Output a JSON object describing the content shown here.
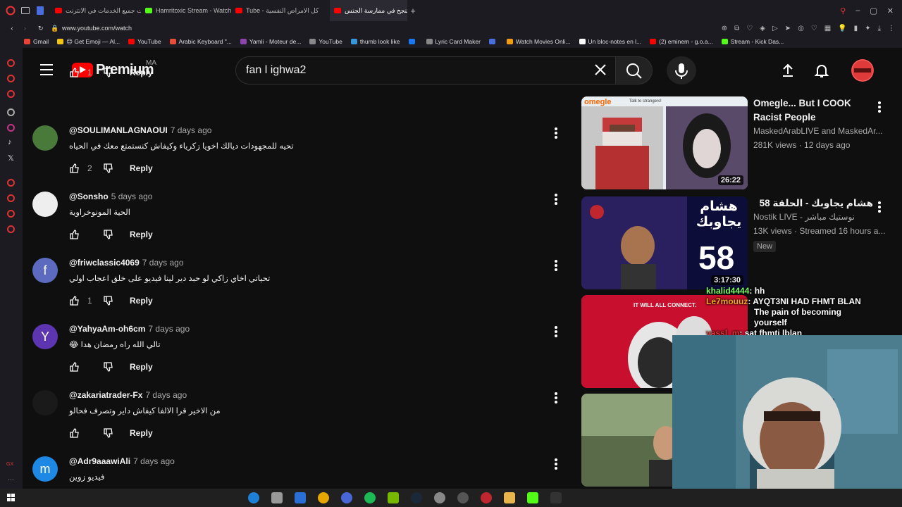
{
  "browser": {
    "tabs": [
      {
        "label": "جربت جميع الخدمات في الانترنت",
        "color": "#ff0000"
      },
      {
        "label": "Hamritoxic Stream - Watch",
        "color": "#53fc18"
      },
      {
        "label": "Tube - كل الامراض النفسية",
        "color": "#ff0000"
      },
      {
        "label": "لماذا تنجح في ممارسة الجنس",
        "color": "#ff0000"
      }
    ],
    "new_tab": "+",
    "url": "www.youtube.com/watch",
    "bookmarks": [
      {
        "label": "Gmail",
        "color": "#ea4335"
      },
      {
        "label": "😊 Get Emoji — Al...",
        "color": "#f1c40f"
      },
      {
        "label": "YouTube",
        "color": "#ff0000"
      },
      {
        "label": "Arabic Keyboard \"...",
        "color": "#e74c3c"
      },
      {
        "label": "Yamli - Moteur de...",
        "color": "#8e44ad"
      },
      {
        "label": "YouTube",
        "color": "#888888"
      },
      {
        "label": "thumb look like",
        "color": "#3498db"
      },
      {
        "label": "",
        "color": "#1877f2"
      },
      {
        "label": "Lyric Card Maker",
        "color": "#888888"
      },
      {
        "label": "",
        "color": "#4a6ee0"
      },
      {
        "label": "Watch Movies Onli...",
        "color": "#f39c12"
      },
      {
        "label": "Un bloc-notes en l...",
        "color": "#ffffff"
      },
      {
        "label": "(2) eminem - g.o.a...",
        "color": "#ff0000"
      },
      {
        "label": "Stream - Kick Das...",
        "color": "#53fc18"
      }
    ]
  },
  "header": {
    "logo_text": "Premium",
    "region": "MA",
    "search_value": "fan l ighwa2"
  },
  "comments": [
    {
      "user": "",
      "time": "",
      "text": "",
      "likes": "1",
      "reply": "Reply",
      "avatar_color": "",
      "avatar_letter": ""
    },
    {
      "user": "@SOULIMANLAGNAOUI",
      "time": "7 days ago",
      "text": "تحيه للمجهودات ديالك اخويا زكرياء وكيفاش كنستمتع معك في الحياه",
      "likes": "2",
      "reply": "Reply",
      "avatar_color": "#4a7a3a",
      "avatar_letter": ""
    },
    {
      "user": "@Sonsho",
      "time": "5 days ago",
      "text": "الحية المونوخراوية",
      "likes": "",
      "reply": "Reply",
      "avatar_color": "#eeeeee",
      "avatar_letter": ""
    },
    {
      "user": "@friwclassic4069",
      "time": "7 days ago",
      "text": "تحياتي اخاي زاكي لو حبد دير لينا فيديو على خلق اعجاب اولي",
      "likes": "1",
      "reply": "Reply",
      "avatar_color": "#5c6bc0",
      "avatar_letter": "f"
    },
    {
      "user": "@YahyaAm-oh6cm",
      "time": "7 days ago",
      "text": "تالي الله راه رمضان هدا 😂",
      "likes": "",
      "reply": "Reply",
      "avatar_color": "#5e35b1",
      "avatar_letter": "Y"
    },
    {
      "user": "@zakariatrader-Fx",
      "time": "7 days ago",
      "text": "من الاخير قرا الالفا كيفاش داير وتصرف فحالو",
      "likes": "",
      "reply": "Reply",
      "avatar_color": "#1a1a1a",
      "avatar_letter": ""
    },
    {
      "user": "@Adr9aaawiAli",
      "time": "7 days ago",
      "text": "فيديو زوين",
      "likes": "",
      "reply": "",
      "avatar_color": "#1e88e5",
      "avatar_letter": "m"
    }
  ],
  "related": [
    {
      "title": "Omegle... But I COOK Racist People",
      "channel": "MaskedArabLIVE and MaskedAr...",
      "meta": "281K views · 12 days ago",
      "duration": "26:22",
      "badge": "",
      "thumb_color": "#b7c9d6"
    },
    {
      "title": "هشام يجاوبك - الحلقة 58",
      "channel": "Nostik LIVE - نوستيك مباشر",
      "meta": "13K views · Streamed 16 hours a...",
      "duration": "3:17:30",
      "badge": "New",
      "thumb_color": "#1a1450"
    },
    {
      "title": "",
      "channel": "",
      "meta": "",
      "duration": "",
      "badge": "",
      "thumb_color": "#c8102e",
      "thumb_text": "IT WILL ALL CONNECT."
    },
    {
      "title": "",
      "channel": "",
      "meta": "",
      "duration": "",
      "badge": "",
      "thumb_color": "#5a6b4a"
    }
  ],
  "thumb_texts": {
    "omegle": "omegle",
    "talk": "Talk to strangers!",
    "hisham": "هشام يجاوبك",
    "ep": "58"
  },
  "stream_chat": [
    {
      "user": "khalid4444",
      "text": ": hh",
      "user_color": "#7cfc6a"
    },
    {
      "user": "Le7mouuz",
      "text": ": AYQT3NI HAD FHMT BLAN",
      "user_color": "#f5a623"
    },
    {
      "user": "",
      "text": "The pain of becoming yourself",
      "user_color": ""
    },
    {
      "user": "yassl_m",
      "text": ": sat fhmti lblan",
      "user_color": "#e03a3a"
    }
  ]
}
